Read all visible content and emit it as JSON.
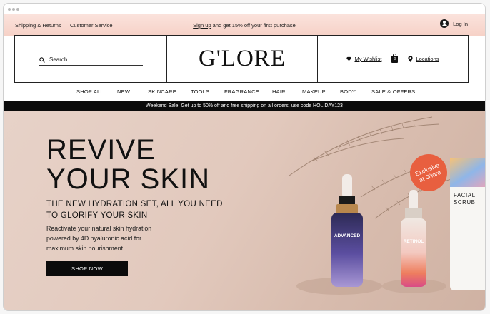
{
  "topbar": {
    "shipping": "Shipping & Returns",
    "customer_service": "Customer Service",
    "promo_signup": "Sign up",
    "promo_rest": " and get 15% off your first purchase",
    "login": "Log In"
  },
  "header": {
    "search_placeholder": "Search...",
    "logo": "G'LORE",
    "wishlist": "My Wishlist",
    "bag_count": "0",
    "locations": "Locations"
  },
  "nav": {
    "items": [
      "SHOP ALL",
      "NEW",
      "SKINCARE",
      "TOOLS",
      "FRAGRANCE",
      "HAIR",
      "MAKEUP",
      "BODY",
      "SALE & OFFERS"
    ]
  },
  "sale_bar": "Weekend Sale! Get up to 50% off and free shipping on all orders, use code HOLIDAY123",
  "hero": {
    "title_line1": "REVIVE",
    "title_line2": "YOUR SKIN",
    "subtitle_line1": "THE NEW HYDRATION SET, ALL YOU NEED",
    "subtitle_line2": "TO GLORIFY YOUR SKIN",
    "body_line1": "Reactivate your natural skin hydration",
    "body_line2": "powered by 4D hyaluronic acid for",
    "body_line3": "maximum skin nourishment",
    "cta": "SHOP NOW",
    "badge_line1": "Exclusive",
    "badge_line2": "at G'lore",
    "product1_label": "ADVANCED",
    "product2_label": "RETINOL",
    "product3_line1": "FACIAL",
    "product3_line2": "SCRUB"
  },
  "colors": {
    "topbar_pink": "#f6d1c6",
    "badge_orange": "#e85f3f",
    "hero_bg": "#e2c9bd"
  }
}
